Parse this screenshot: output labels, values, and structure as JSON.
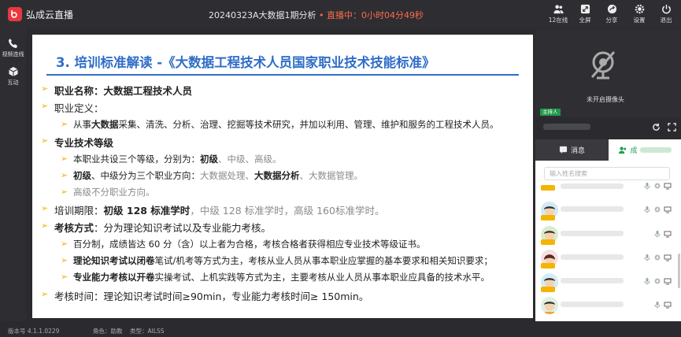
{
  "app": {
    "title": "弘成云直播",
    "session": "20240323A大数据1期分析",
    "live_status": "• 直播中：0小时04分49秒"
  },
  "toolbar": [
    {
      "label": "12在线",
      "icon": "users-icon"
    },
    {
      "label": "全屏",
      "icon": "fullscreen-icon"
    },
    {
      "label": "分享",
      "icon": "share-icon"
    },
    {
      "label": "设置",
      "icon": "gear-icon"
    },
    {
      "label": "退出",
      "icon": "exit-icon"
    }
  ],
  "leftbar": [
    {
      "label": "视频连线",
      "icon": "phone-icon"
    },
    {
      "label": "互动",
      "icon": "cube-icon"
    }
  ],
  "slide": {
    "title": "3. 培训标准解读 -《大数据工程技术人员国家职业技术技能标准》",
    "lines": {
      "l1": "职业名称：大数据工程技术人员",
      "l2": "职业定义：",
      "l3a": "从事",
      "l3b": "大数据",
      "l3c": "采集、清洗、分析、治理、挖掘等技术研究，并加以利用、管理、维护和服务的工程技术人员。",
      "l4": "专业技术等级",
      "l5a": "本职业共设三个等级，分别为：",
      "l5b": "初级",
      "l5c": "、中级、高级。",
      "l6a": "初级",
      "l6b": "、中级分为三个职业方向：",
      "l6c": "大数据处理、",
      "l6d": "大数据分析",
      "l6e": "、大数据管理。",
      "l7": "高级不分职业方向。",
      "l8a": "培训期限：",
      "l8b": "初级 128 标准学时",
      "l8c": "，中级 128 标准学时，高级 160标准学时。",
      "l9a": "考核方式",
      "l9b": "：分为理论知识考试以及专业能力考核。",
      "l10": "百分制，成绩皆达 60 分（含）以上者为合格，考核合格者获得相应专业技术等级证书。",
      "l11a": "理论知识考试以闭卷",
      "l11b": "笔试/机考等方式为主，考核从业人员从事本职业应掌握的基本要求和相关知识要求；",
      "l12a": "专业能力考核以开卷",
      "l12b": "实操考试、上机实践等方式为主，主要考核从业人员从事本职业应具备的技术水平。",
      "l13": "考核时间：理论知识考试时间≥90min，专业能力考核时间≥ 150min。"
    }
  },
  "video": {
    "camera_status": "未开启摄像头",
    "host_badge": "主持人"
  },
  "tabs": {
    "messages": "消息",
    "members": "成"
  },
  "members": {
    "search_placeholder": "输入姓名搜索"
  },
  "footer": {
    "version": "版本号 4.1.1.0229",
    "role": "角色：助教",
    "type": "类型：AILSS"
  },
  "colors": {
    "accent": "#2f6dc8",
    "live": "#ff6a4d",
    "brand": "#e8383d",
    "member_tab": "#1aa04e"
  }
}
